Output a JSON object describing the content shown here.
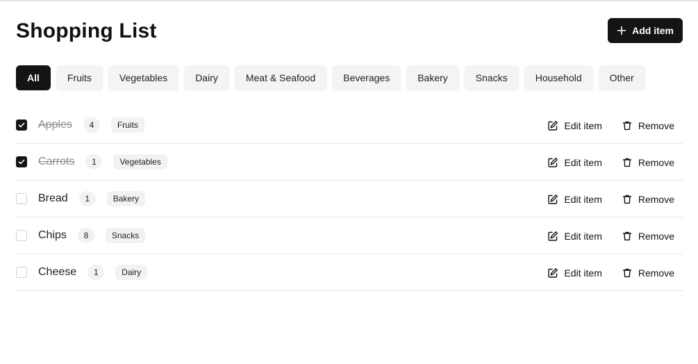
{
  "header": {
    "title": "Shopping List",
    "add_label": "Add item"
  },
  "filters": [
    "All",
    "Fruits",
    "Vegetables",
    "Dairy",
    "Meat & Seafood",
    "Beverages",
    "Bakery",
    "Snacks",
    "Household",
    "Other"
  ],
  "active_filter": "All",
  "items": [
    {
      "name": "Apples",
      "qty": "4",
      "category": "Fruits",
      "checked": true
    },
    {
      "name": "Carrots",
      "qty": "1",
      "category": "Vegetables",
      "checked": true
    },
    {
      "name": "Bread",
      "qty": "1",
      "category": "Bakery",
      "checked": false
    },
    {
      "name": "Chips",
      "qty": "8",
      "category": "Snacks",
      "checked": false
    },
    {
      "name": "Cheese",
      "qty": "1",
      "category": "Dairy",
      "checked": false
    }
  ],
  "row_actions": {
    "edit_label": "Edit item",
    "remove_label": "Remove"
  },
  "icons": {
    "add": "plus-icon",
    "edit": "edit-icon",
    "remove": "trash-icon",
    "check": "check-icon"
  },
  "colors": {
    "primary": "#141414",
    "chip_bg": "#f4f4f4",
    "divider": "#e5e5e5"
  }
}
